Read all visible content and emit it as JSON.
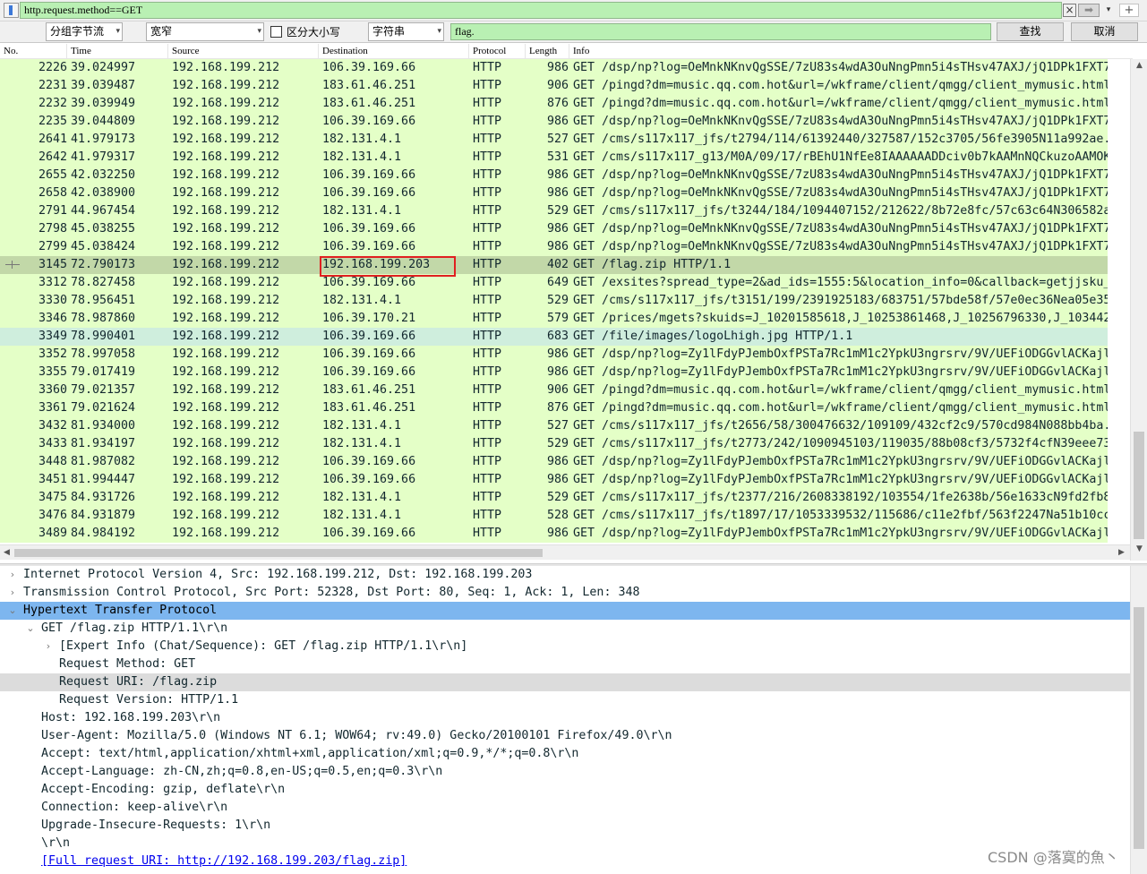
{
  "filter_bar": {
    "value": "http.request.method==GET",
    "clear_icon": "×",
    "apply_icon": "➡",
    "history_icon": "▾",
    "add_icon": "+"
  },
  "find_bar": {
    "search_in": "分组字节流",
    "char_width": "宽窄",
    "case_label": "区分大小写",
    "search_type": "字符串",
    "search_value": "flag.",
    "find_label": "查找",
    "cancel_label": "取消",
    "dropdown_icon": "▾"
  },
  "packet_list": {
    "columns": [
      "No.",
      "Time",
      "Source",
      "Destination",
      "Protocol",
      "Length",
      "Info"
    ],
    "rows": [
      {
        "no": "2226",
        "time": "39.024997",
        "src": "192.168.199.212",
        "dst": "106.39.169.66",
        "proto": "HTTP",
        "len": "986",
        "info": "GET /dsp/np?log=OeMnkNKnvQgSSE/7zU83s4wdA3OuNngPmn5i4sTHsv47AXJ/jQ1DPk1FXT7"
      },
      {
        "no": "2231",
        "time": "39.039487",
        "src": "192.168.199.212",
        "dst": "183.61.46.251",
        "proto": "HTTP",
        "len": "906",
        "info": "GET /pingd?dm=music.qq.com.hot&url=/wkframe/client/qmgg/client_mymusic.html"
      },
      {
        "no": "2232",
        "time": "39.039949",
        "src": "192.168.199.212",
        "dst": "183.61.46.251",
        "proto": "HTTP",
        "len": "876",
        "info": "GET /pingd?dm=music.qq.com.hot&url=/wkframe/client/qmgg/client_mymusic.html"
      },
      {
        "no": "2235",
        "time": "39.044809",
        "src": "192.168.199.212",
        "dst": "106.39.169.66",
        "proto": "HTTP",
        "len": "986",
        "info": "GET /dsp/np?log=OeMnkNKnvQgSSE/7zU83s4wdA3OuNngPmn5i4sTHsv47AXJ/jQ1DPk1FXT7"
      },
      {
        "no": "2641",
        "time": "41.979173",
        "src": "192.168.199.212",
        "dst": "182.131.4.1",
        "proto": "HTTP",
        "len": "527",
        "info": "GET /cms/s117x117_jfs/t2794/114/61392440/327587/152c3705/56fe3905N11a992ae."
      },
      {
        "no": "2642",
        "time": "41.979317",
        "src": "192.168.199.212",
        "dst": "182.131.4.1",
        "proto": "HTTP",
        "len": "531",
        "info": "GET /cms/s117x117_g13/M0A/09/17/rBEhU1NfEe8IAAAAAADDciv0b7kAAMnNQCkuzoAAMOK"
      },
      {
        "no": "2655",
        "time": "42.032250",
        "src": "192.168.199.212",
        "dst": "106.39.169.66",
        "proto": "HTTP",
        "len": "986",
        "info": "GET /dsp/np?log=OeMnkNKnvQgSSE/7zU83s4wdA3OuNngPmn5i4sTHsv47AXJ/jQ1DPk1FXT7"
      },
      {
        "no": "2658",
        "time": "42.038900",
        "src": "192.168.199.212",
        "dst": "106.39.169.66",
        "proto": "HTTP",
        "len": "986",
        "info": "GET /dsp/np?log=OeMnkNKnvQgSSE/7zU83s4wdA3OuNngPmn5i4sTHsv47AXJ/jQ1DPk1FXT7"
      },
      {
        "no": "2791",
        "time": "44.967454",
        "src": "192.168.199.212",
        "dst": "182.131.4.1",
        "proto": "HTTP",
        "len": "529",
        "info": "GET /cms/s117x117_jfs/t3244/184/1094407152/212622/8b72e8fc/57c63c64N306582a"
      },
      {
        "no": "2798",
        "time": "45.038255",
        "src": "192.168.199.212",
        "dst": "106.39.169.66",
        "proto": "HTTP",
        "len": "986",
        "info": "GET /dsp/np?log=OeMnkNKnvQgSSE/7zU83s4wdA3OuNngPmn5i4sTHsv47AXJ/jQ1DPk1FXT7"
      },
      {
        "no": "2799",
        "time": "45.038424",
        "src": "192.168.199.212",
        "dst": "106.39.169.66",
        "proto": "HTTP",
        "len": "986",
        "info": "GET /dsp/np?log=OeMnkNKnvQgSSE/7zU83s4wdA3OuNngPmn5i4sTHsv47AXJ/jQ1DPk1FXT7"
      },
      {
        "no": "3145",
        "time": "72.790173",
        "src": "192.168.199.212",
        "dst": "192.168.199.203",
        "proto": "HTTP",
        "len": "402",
        "info": "GET /flag.zip HTTP/1.1"
      },
      {
        "no": "3312",
        "time": "78.827458",
        "src": "192.168.199.212",
        "dst": "106.39.169.66",
        "proto": "HTTP",
        "len": "649",
        "info": "GET /exsites?spread_type=2&ad_ids=1555:5&location_info=0&callback=getjjsku_"
      },
      {
        "no": "3330",
        "time": "78.956451",
        "src": "192.168.199.212",
        "dst": "182.131.4.1",
        "proto": "HTTP",
        "len": "529",
        "info": "GET /cms/s117x117_jfs/t3151/199/2391925183/683751/57bde58f/57e0ec36Nea05e35"
      },
      {
        "no": "3346",
        "time": "78.987860",
        "src": "192.168.199.212",
        "dst": "106.39.170.21",
        "proto": "HTTP",
        "len": "579",
        "info": "GET /prices/mgets?skuids=J_10201585618,J_10253861468,J_10256796330,J_103442"
      },
      {
        "no": "3349",
        "time": "78.990401",
        "src": "192.168.199.212",
        "dst": "106.39.169.66",
        "proto": "HTTP",
        "len": "683",
        "info": "GET /file/images/logoLhigh.jpg HTTP/1.1"
      },
      {
        "no": "3352",
        "time": "78.997058",
        "src": "192.168.199.212",
        "dst": "106.39.169.66",
        "proto": "HTTP",
        "len": "986",
        "info": "GET /dsp/np?log=Zy1lFdyPJembOxfPSTa7Rc1mM1c2YpkU3ngrsrv/9V/UEFiODGGvlACKajl"
      },
      {
        "no": "3355",
        "time": "79.017419",
        "src": "192.168.199.212",
        "dst": "106.39.169.66",
        "proto": "HTTP",
        "len": "986",
        "info": "GET /dsp/np?log=Zy1lFdyPJembOxfPSTa7Rc1mM1c2YpkU3ngrsrv/9V/UEFiODGGvlACKajl"
      },
      {
        "no": "3360",
        "time": "79.021357",
        "src": "192.168.199.212",
        "dst": "183.61.46.251",
        "proto": "HTTP",
        "len": "906",
        "info": "GET /pingd?dm=music.qq.com.hot&url=/wkframe/client/qmgg/client_mymusic.html"
      },
      {
        "no": "3361",
        "time": "79.021624",
        "src": "192.168.199.212",
        "dst": "183.61.46.251",
        "proto": "HTTP",
        "len": "876",
        "info": "GET /pingd?dm=music.qq.com.hot&url=/wkframe/client/qmgg/client_mymusic.html"
      },
      {
        "no": "3432",
        "time": "81.934000",
        "src": "192.168.199.212",
        "dst": "182.131.4.1",
        "proto": "HTTP",
        "len": "527",
        "info": "GET /cms/s117x117_jfs/t2656/58/300476632/109109/432cf2c9/570cd984N088bb4ba."
      },
      {
        "no": "3433",
        "time": "81.934197",
        "src": "192.168.199.212",
        "dst": "182.131.4.1",
        "proto": "HTTP",
        "len": "529",
        "info": "GET /cms/s117x117_jfs/t2773/242/1090945103/119035/88b08cf3/5732f4cfN39eee73"
      },
      {
        "no": "3448",
        "time": "81.987082",
        "src": "192.168.199.212",
        "dst": "106.39.169.66",
        "proto": "HTTP",
        "len": "986",
        "info": "GET /dsp/np?log=Zy1lFdyPJembOxfPSTa7Rc1mM1c2YpkU3ngrsrv/9V/UEFiODGGvlACKajl"
      },
      {
        "no": "3451",
        "time": "81.994447",
        "src": "192.168.199.212",
        "dst": "106.39.169.66",
        "proto": "HTTP",
        "len": "986",
        "info": "GET /dsp/np?log=Zy1lFdyPJembOxfPSTa7Rc1mM1c2YpkU3ngrsrv/9V/UEFiODGGvlACKajl"
      },
      {
        "no": "3475",
        "time": "84.931726",
        "src": "192.168.199.212",
        "dst": "182.131.4.1",
        "proto": "HTTP",
        "len": "529",
        "info": "GET /cms/s117x117_jfs/t2377/216/2608338192/103554/1fe2638b/56e1633cN9fd2fb8"
      },
      {
        "no": "3476",
        "time": "84.931879",
        "src": "192.168.199.212",
        "dst": "182.131.4.1",
        "proto": "HTTP",
        "len": "528",
        "info": "GET /cms/s117x117_jfs/t1897/17/1053339532/115686/c11e2fbf/563f2247Na51b10cc"
      },
      {
        "no": "3489",
        "time": "84.984192",
        "src": "192.168.199.212",
        "dst": "106.39.169.66",
        "proto": "HTTP",
        "len": "986",
        "info": "GET /dsp/np?log=Zy1lFdyPJembOxfPSTa7Rc1mM1c2YpkU3ngrsrv/9V/UEFiODGGvlACKajl"
      }
    ],
    "selected_no": "3145",
    "highlighted_no": "3349",
    "scroll_up_icon": "▲",
    "scroll_down_icon": "▼",
    "scroll_left_icon": "◀",
    "scroll_right_icon": "▶"
  },
  "details": {
    "expand_collapsed_icon": "›",
    "expand_open_icon": "⌄",
    "lines": [
      {
        "text": "Internet Protocol Version 4, Src: 192.168.199.212, Dst: 192.168.199.203",
        "expander": "collapsed",
        "level": 0,
        "style": ""
      },
      {
        "text": "Transmission Control Protocol, Src Port: 52328, Dst Port: 80, Seq: 1, Ack: 1, Len: 348",
        "expander": "collapsed",
        "level": 0,
        "style": ""
      },
      {
        "text": "Hypertext Transfer Protocol",
        "expander": "open",
        "level": 0,
        "style": "sel"
      },
      {
        "text": "GET /flag.zip HTTP/1.1\\r\\n",
        "expander": "open",
        "level": 1,
        "style": ""
      },
      {
        "text": "[Expert Info (Chat/Sequence): GET /flag.zip HTTP/1.1\\r\\n]",
        "expander": "collapsed",
        "level": 2,
        "style": ""
      },
      {
        "text": "Request Method: GET",
        "expander": "",
        "level": 2,
        "style": ""
      },
      {
        "text": "Request URI: /flag.zip",
        "expander": "",
        "level": 2,
        "style": "alt"
      },
      {
        "text": "Request Version: HTTP/1.1",
        "expander": "",
        "level": 2,
        "style": ""
      },
      {
        "text": "Host: 192.168.199.203\\r\\n",
        "expander": "",
        "level": 1,
        "style": ""
      },
      {
        "text": "User-Agent: Mozilla/5.0 (Windows NT 6.1; WOW64; rv:49.0) Gecko/20100101 Firefox/49.0\\r\\n",
        "expander": "",
        "level": 1,
        "style": ""
      },
      {
        "text": "Accept: text/html,application/xhtml+xml,application/xml;q=0.9,*/*;q=0.8\\r\\n",
        "expander": "",
        "level": 1,
        "style": ""
      },
      {
        "text": "Accept-Language: zh-CN,zh;q=0.8,en-US;q=0.5,en;q=0.3\\r\\n",
        "expander": "",
        "level": 1,
        "style": ""
      },
      {
        "text": "Accept-Encoding: gzip, deflate\\r\\n",
        "expander": "",
        "level": 1,
        "style": ""
      },
      {
        "text": "Connection: keep-alive\\r\\n",
        "expander": "",
        "level": 1,
        "style": ""
      },
      {
        "text": "Upgrade-Insecure-Requests: 1\\r\\n",
        "expander": "",
        "level": 1,
        "style": ""
      },
      {
        "text": "\\r\\n",
        "expander": "",
        "level": 1,
        "style": ""
      },
      {
        "text": "[Full request URI: http://192.168.199.203/flag.zip]",
        "expander": "",
        "level": 1,
        "style": "link"
      }
    ]
  },
  "watermark": "CSDN @落寞的魚丶",
  "colors": {
    "row_bg": "#e4ffc7",
    "row_selected_bg": "#c2d8a8",
    "row_highlight_bg": "#cfeedd",
    "filter_bg": "#b9f0b3",
    "detail_selected_bg": "#7db6ef",
    "annotation_box": "#e02020"
  }
}
